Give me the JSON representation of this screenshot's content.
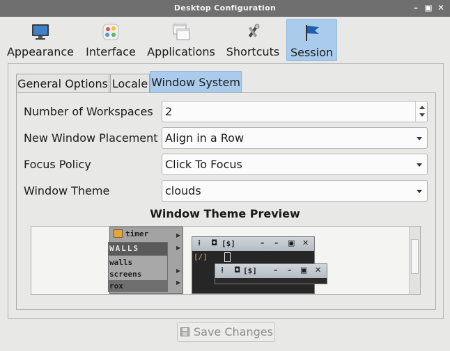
{
  "window": {
    "title": "Desktop Configuration",
    "minimize_glyph": "–",
    "maximize_glyph": "▣",
    "close_glyph": "✕"
  },
  "toolbar": {
    "items": [
      {
        "label": "Appearance",
        "icon": "monitor-icon"
      },
      {
        "label": "Interface",
        "icon": "palette-icon"
      },
      {
        "label": "Applications",
        "icon": "windows-icon"
      },
      {
        "label": "Shortcuts",
        "icon": "tools-icon"
      },
      {
        "label": "Session",
        "icon": "flag-icon",
        "active": true
      }
    ]
  },
  "tabs": [
    {
      "label": "General Options"
    },
    {
      "label": "Locale"
    },
    {
      "label": "Window System",
      "active": true
    }
  ],
  "form": {
    "workspaces": {
      "label": "Number of Workspaces",
      "value": "2"
    },
    "placement": {
      "label": "New Window Placement",
      "value": "Align in a Row"
    },
    "focus": {
      "label": "Focus Policy",
      "value": "Click To Focus"
    },
    "theme": {
      "label": "Window Theme",
      "value": "clouds"
    }
  },
  "preview": {
    "title": "Window Theme Preview",
    "menu_items": [
      "timer",
      "WALLS",
      "walls",
      "screens",
      "rox"
    ],
    "win1_title": "[$]",
    "win2_title": "[$]",
    "prompt": "[/]"
  },
  "actions": {
    "save_label": "Save Changes"
  },
  "colors": {
    "accent": "#aacbec",
    "titlebar": "#6f6f6f",
    "background": "#e8e8e7"
  }
}
